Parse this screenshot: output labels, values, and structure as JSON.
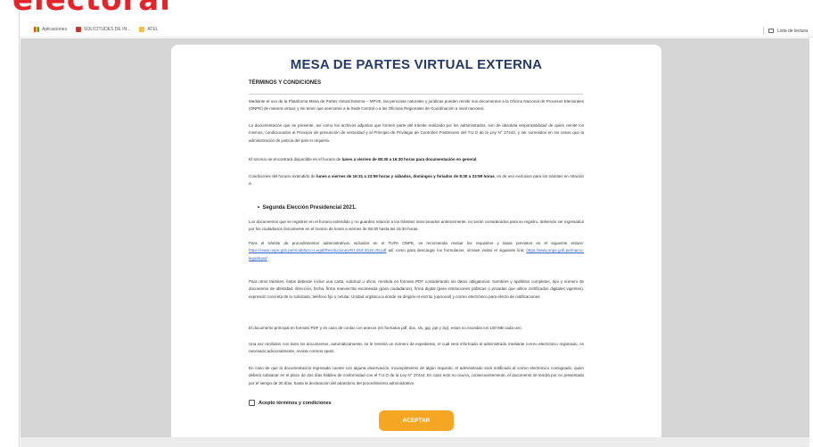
{
  "overlay_text": "electoral",
  "browser": {
    "bookmarks": [
      {
        "label": "Aplicaciones",
        "icon": "apps-grid-icon"
      },
      {
        "label": "SOLICITUDES DE IN...",
        "icon": "bookmark-red-icon"
      },
      {
        "label": "ATEL",
        "icon": "folder-icon"
      }
    ],
    "reading_list": "Lista de lectura"
  },
  "card": {
    "title": "MESA DE PARTES VIRTUAL EXTERNA",
    "section_title": "TÉRMINOS Y CONDICIONES",
    "p1": "Mediante el uso de la Plataforma Mesa de Partes Virtual Externa – MPVE, las personas naturales y jurídicas pueden remitir sus documentos a la Oficina Nacional de Procesos Electorales (ONPE) de manera virtual, y sin tener que acercarse a la Sede Central o a las Oficinas Regionales de Coordinación a nivel nacional.",
    "p2": "La documentación que se presente, así como los archivos adjuntos que formen parte del trámite realizado por los administrados, son de absoluta responsabilidad de quien remite los mismos, condicionados al Principio de presunción de veracidad y al Principio de Privilegio de Controles Posteriores del T.U.O de la Ley N° 27444, y ser sometidos en los casos que la administración de justicia del país lo requiera.",
    "p3_pre": "El servicio se encontrará disponible en el horario de ",
    "p3_bold": "lunes a viernes de 08:30 a 16:30 horas para documentación en general",
    "p3_post": ".",
    "p4_pre": "Condiciones del horario extendido de ",
    "p4_bold": "lunes a viernes de 16:31 a 23:59 horas y sábados, domingos y feriados de 8:30 a 23:59 horas",
    "p4_post": ", es de uso exclusivo para los trámites en relación a:",
    "bullet": "Segunda Elección Presidencial 2021.",
    "p5": "Los documentos que se registren en el horario extendido y no guarden relación a los trámites mencionados anteriormente, no serán considerados para su registro, debiendo ser ingresados por los ciudadanos únicamente en el horario de lunes a viernes de 08:30 hasta las 16:30 horas.",
    "p6_pre": "Para el trámite de procedimientos administrativos incluidos en el TUPA ONPE, se recomienda revisar los requisitos y tasas previstos en el siguiente enlace: ",
    "p6_link1": "https://www.onpe.gob.pe/modMarco-Legal/Resoluciones/RJ-264-2019-JN.pdf",
    "p6_mid": " así como para descargar los formularios, sírvase visitar el siguiente link: ",
    "p6_link2": "https://www.onpe.gob.pe/marco-legal/tupa/",
    "p7": "Para otros trámites, éstos deberán incluir una carta, solicitud u oficio, remitida en formato PDF considerando los datos obligatorios: Nombres y apellidos completos, tipo y número de documento de identidad, dirección, fecha, firma manuscrita escaneada (para ciudadanos), firma digital (para instituciones públicas o privadas que utilice certificados digitales vigentes), expresión concreta de lo solicitado, teléfono fijo o celular, Unidad orgánica a donde va dirigido el escrito (opcional) y correo electrónico para efecto de notificaciones.",
    "p8": "El documento principal en formato PDF y en caso de contar con anexos (en formatos pdf, doc, xls, jpg, ppt y zip), estos no excedan los 100 MB cada uno.",
    "p9": "Una vez recibidos con éxito los documentos, automáticamente, se le remitirá un número de expediente, el cual será informado al administrado mediante correo electrónico registrado, es necesario adicionalmente, revisar correos spam.",
    "p10": "En caso de que la documentación ingresada cuente con alguna observación, incumplimiento de algún requisito, el administrado será notificado al correo electrónico consignado, quien deberá subsanar en el plazo de dos días hábiles de conformidad con el T.U.O de la Ley N° 27444. En caso esto no ocurra, consecuentemente, el documento se tendrá por no presentado por el tiempo de 30 días, hasta la declaración del abandono del procedimiento administrativo.",
    "accept_label": "Acepto términos y condiciones",
    "accept_button": "ACEPTAR"
  },
  "colors": {
    "title": "#233a6b",
    "button": "#f5a623",
    "overlay_text": "#e3242b",
    "page_bg": "#d6d6d6"
  }
}
